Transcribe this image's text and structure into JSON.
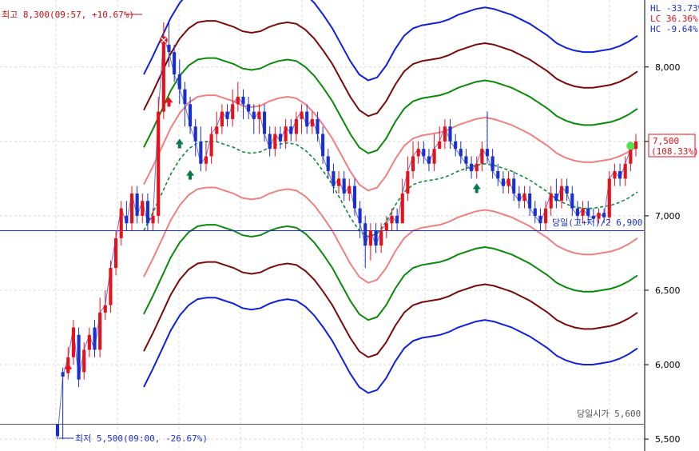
{
  "chart_data": {
    "type": "candlestick",
    "ylim": [
      5420,
      8450
    ],
    "y_ticks": [
      5500,
      6000,
      6500,
      7000,
      7500,
      8000
    ],
    "y_tick_labels": [
      "5,500",
      "6,000",
      "6,500",
      "7,000",
      "7,500",
      "8,000"
    ],
    "annotations": {
      "high_label": "최고 8,300(09:57, +10.67%)",
      "low_label": "최저 5,500(09:00, -26.67%)",
      "mid_label": "당일(고+저)/2 6,900",
      "open_label": "당일시가 5,600",
      "current_price_label": "7,500",
      "current_pct_label": "(108.33%)"
    },
    "stats": [
      {
        "label": "HL",
        "value": "-33.73%"
      },
      {
        "label": "LC",
        "value": "36.36%"
      },
      {
        "label": "HC",
        "value": "-9.64%"
      }
    ],
    "reference_lines": {
      "mid": 6900,
      "open": 5600,
      "high": 8300,
      "low": 5500,
      "current": 7500
    },
    "colors": {
      "up": "#e8101a",
      "down": "#1a2fd0",
      "outer_band": "#1020e0",
      "second_band": "#7a0a0a",
      "third_band": "#0a8a0a",
      "inner_band": "#f08080",
      "center_line": "#0a8a3a",
      "close_line": "#7070d0"
    },
    "candles": [
      [
        5600,
        5520,
        5550,
        5500
      ],
      [
        5950,
        5920,
        5980,
        5500
      ],
      [
        5950,
        6050,
        6120,
        5900
      ],
      [
        6050,
        6250,
        6300,
        6000
      ],
      [
        6200,
        5900,
        6250,
        5850
      ],
      [
        5950,
        6100,
        6150,
        5900
      ],
      [
        6100,
        6200,
        6250,
        6050
      ],
      [
        6250,
        6100,
        6300,
        6050
      ],
      [
        6100,
        6350,
        6450,
        6050
      ],
      [
        6350,
        6400,
        6500,
        6300
      ],
      [
        6400,
        6650,
        6700,
        6350
      ],
      [
        6650,
        6850,
        6900,
        6600
      ],
      [
        6850,
        7050,
        7100,
        6800
      ],
      [
        7000,
        6950,
        7100,
        6900
      ],
      [
        6950,
        7150,
        7200,
        6900
      ],
      [
        7150,
        7000,
        7200,
        6950
      ],
      [
        7000,
        7100,
        7150,
        6950
      ],
      [
        7100,
        6950,
        7150,
        6900
      ],
      [
        6950,
        7000,
        7050,
        6900
      ],
      [
        7000,
        7700,
        7800,
        6950
      ],
      [
        7700,
        8200,
        8300,
        7650
      ],
      [
        8150,
        8100,
        8300,
        8000
      ],
      [
        8100,
        7950,
        8150,
        7900
      ],
      [
        7950,
        7850,
        8050,
        7750
      ],
      [
        7850,
        7750,
        7900,
        7600
      ],
      [
        7750,
        7600,
        7800,
        7550
      ],
      [
        7600,
        7500,
        7650,
        7400
      ],
      [
        7500,
        7350,
        7600,
        7300
      ],
      [
        7350,
        7400,
        7500,
        7300
      ],
      [
        7400,
        7550,
        7600,
        7350
      ],
      [
        7550,
        7600,
        7700,
        7500
      ],
      [
        7600,
        7700,
        7750,
        7550
      ],
      [
        7700,
        7650,
        7750,
        7600
      ],
      [
        7650,
        7750,
        7850,
        7600
      ],
      [
        7750,
        7800,
        7900,
        7700
      ],
      [
        7800,
        7750,
        7850,
        7650
      ],
      [
        7750,
        7700,
        7800,
        7650
      ],
      [
        7700,
        7650,
        7750,
        7550
      ],
      [
        7650,
        7700,
        7750,
        7550
      ],
      [
        7700,
        7550,
        7750,
        7500
      ],
      [
        7550,
        7450,
        7600,
        7400
      ],
      [
        7450,
        7550,
        7600,
        7400
      ],
      [
        7550,
        7500,
        7600,
        7450
      ],
      [
        7500,
        7600,
        7650,
        7450
      ],
      [
        7600,
        7550,
        7650,
        7500
      ],
      [
        7550,
        7650,
        7700,
        7500
      ],
      [
        7650,
        7700,
        7750,
        7550
      ],
      [
        7700,
        7600,
        7750,
        7550
      ],
      [
        7600,
        7650,
        7700,
        7550
      ],
      [
        7650,
        7550,
        7700,
        7500
      ],
      [
        7550,
        7400,
        7600,
        7350
      ],
      [
        7400,
        7300,
        7450,
        7250
      ],
      [
        7300,
        7200,
        7350,
        7150
      ],
      [
        7200,
        7250,
        7300,
        7150
      ],
      [
        7250,
        7150,
        7300,
        7100
      ],
      [
        7150,
        7200,
        7250,
        7100
      ],
      [
        7200,
        7050,
        7250,
        7000
      ],
      [
        7050,
        6950,
        7100,
        6850
      ],
      [
        6950,
        6800,
        7000,
        6650
      ],
      [
        6800,
        6900,
        6950,
        6700
      ],
      [
        6900,
        6800,
        6950,
        6750
      ],
      [
        6800,
        6900,
        6950,
        6750
      ],
      [
        6900,
        6950,
        7000,
        6850
      ],
      [
        6950,
        7000,
        7050,
        6900
      ],
      [
        7000,
        6950,
        7050,
        6900
      ],
      [
        6950,
        7150,
        7250,
        6950
      ],
      [
        7150,
        7300,
        7400,
        7100
      ],
      [
        7300,
        7400,
        7500,
        7250
      ],
      [
        7400,
        7450,
        7500,
        7350
      ],
      [
        7450,
        7400,
        7500,
        7350
      ],
      [
        7400,
        7350,
        7450,
        7300
      ],
      [
        7350,
        7450,
        7550,
        7300
      ],
      [
        7450,
        7500,
        7600,
        7450
      ],
      [
        7500,
        7600,
        7650,
        7450
      ],
      [
        7600,
        7500,
        7650,
        7450
      ],
      [
        7500,
        7450,
        7550,
        7400
      ],
      [
        7450,
        7400,
        7500,
        7350
      ],
      [
        7400,
        7350,
        7450,
        7300
      ],
      [
        7350,
        7300,
        7400,
        7250
      ],
      [
        7300,
        7350,
        7400,
        7250
      ],
      [
        7350,
        7450,
        7500,
        7300
      ],
      [
        7450,
        7400,
        7700,
        7350
      ],
      [
        7400,
        7300,
        7450,
        7250
      ],
      [
        7300,
        7250,
        7350,
        7200
      ],
      [
        7250,
        7200,
        7300,
        7150
      ],
      [
        7200,
        7250,
        7300,
        7150
      ],
      [
        7250,
        7150,
        7300,
        7100
      ],
      [
        7150,
        7100,
        7200,
        7050
      ],
      [
        7100,
        7150,
        7200,
        7050
      ],
      [
        7150,
        7050,
        7200,
        7000
      ],
      [
        7050,
        7000,
        7100,
        6950
      ],
      [
        7000,
        6950,
        7050,
        6900
      ],
      [
        6950,
        7050,
        7100,
        6900
      ],
      [
        7050,
        7150,
        7200,
        7000
      ],
      [
        7150,
        7100,
        7250,
        7050
      ],
      [
        7100,
        7200,
        7250,
        7050
      ],
      [
        7200,
        7150,
        7250,
        7100
      ],
      [
        7150,
        7050,
        7200,
        7000
      ],
      [
        7050,
        7000,
        7100,
        6950
      ],
      [
        7000,
        7050,
        7100,
        6950
      ],
      [
        7050,
        7000,
        7100,
        6950
      ],
      [
        7000,
        6980,
        7050,
        6950
      ],
      [
        6980,
        7020,
        7050,
        6950
      ],
      [
        7020,
        6990,
        7050,
        6950
      ],
      [
        6990,
        7250,
        7300,
        6950
      ],
      [
        7250,
        7300,
        7350,
        7200
      ],
      [
        7300,
        7250,
        7350,
        7200
      ],
      [
        7250,
        7350,
        7400,
        7200
      ],
      [
        7350,
        7450,
        7500,
        7300
      ],
      [
        7450,
        7500,
        7550,
        7400
      ]
    ],
    "center_line": [
      6900,
      7020,
      7150,
      7280,
      7380,
      7450,
      7490,
      7500,
      7500,
      7480,
      7460,
      7430,
      7420,
      7430,
      7460,
      7480,
      7490,
      7480,
      7440,
      7380,
      7300,
      7210,
      7100,
      6990,
      6900,
      6860,
      6880,
      6960,
      7070,
      7160,
      7210,
      7230,
      7240,
      7250,
      7270,
      7300,
      7320,
      7340,
      7350,
      7340,
      7320,
      7300,
      7270,
      7240,
      7200,
      7160,
      7110,
      7080,
      7060,
      7050,
      7050,
      7060,
      7070,
      7090,
      7120,
      7160
    ],
    "band_offsets": [
      1050,
      810,
      560,
      310
    ]
  }
}
